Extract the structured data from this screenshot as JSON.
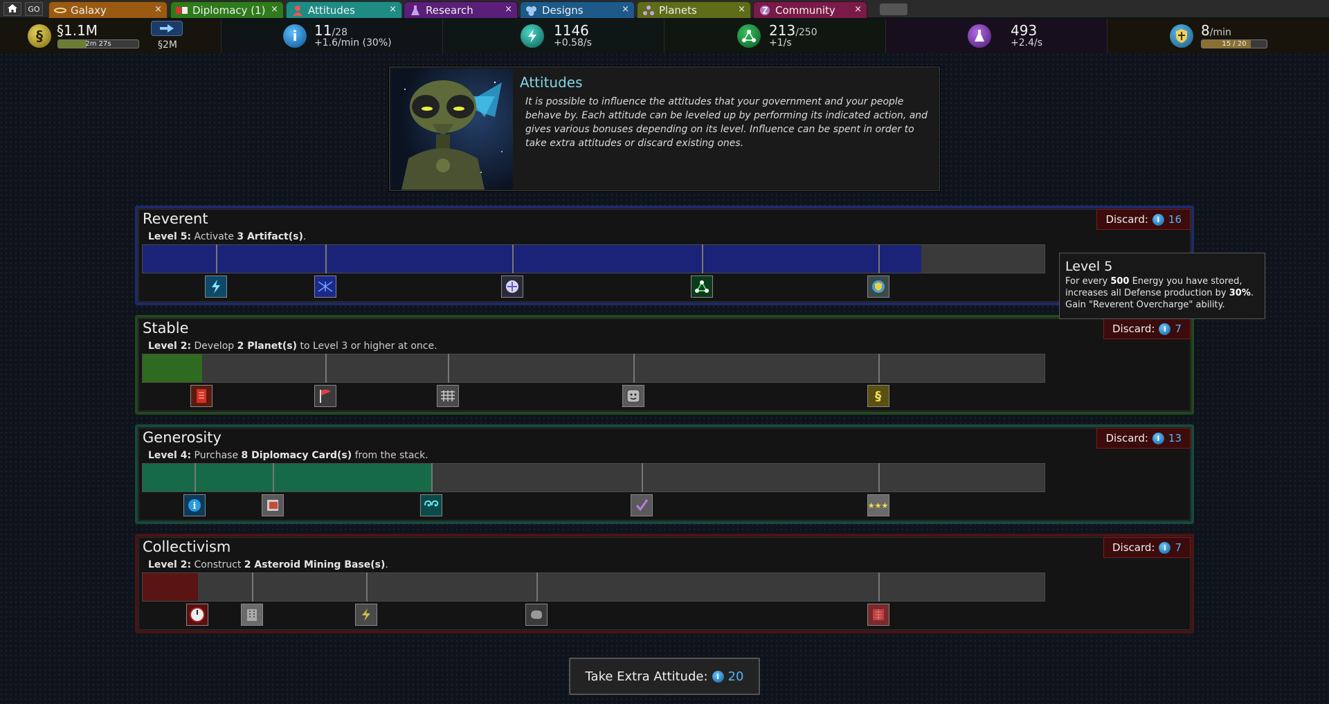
{
  "tabbar": {
    "home_icon": "home-icon",
    "go_label": "GO",
    "tabs": [
      {
        "label": "Galaxy",
        "icon": "galaxy-icon",
        "color": "#9a5a12"
      },
      {
        "label": "Diplomacy (1)",
        "icon": "diplomacy-cards-icon",
        "color": "#2f7a1c"
      },
      {
        "label": "Attitudes",
        "icon": "attitudes-icon",
        "color": "#1f8c84"
      },
      {
        "label": "Research",
        "icon": "research-flask-icon",
        "color": "#5a1f78"
      },
      {
        "label": "Designs",
        "icon": "designs-hex-icon",
        "color": "#1d5a8a"
      },
      {
        "label": "Planets",
        "icon": "planets-icon",
        "color": "#5f6c18"
      },
      {
        "label": "Community",
        "icon": "community-icon",
        "color": "#7a1a48"
      }
    ],
    "close_glyph": "×"
  },
  "resources": {
    "money": {
      "icon": "money-icon",
      "value": "§1.1M",
      "timer": "2m 27s",
      "timer_progress": 0.35,
      "transfer_icon": "transfer-arrow-icon",
      "transfer_value": "§2M"
    },
    "influence": {
      "icon": "influence-icon",
      "value": "11",
      "max": "/28",
      "rate": "+1.6/min (30%)"
    },
    "energy": {
      "icon": "energy-icon",
      "value": "1146",
      "rate": "+0.58/s"
    },
    "industry": {
      "icon": "industry-icon",
      "value": "213",
      "max": "/250",
      "rate": "+1/s"
    },
    "research": {
      "icon": "research-icon",
      "value": "493",
      "rate": "+2.4/s"
    },
    "defense": {
      "icon": "defense-icon",
      "value": "8",
      "unit": "/min",
      "bar_text": "15 / 20",
      "bar_progress": 0.75
    }
  },
  "intro": {
    "title": "Attitudes",
    "text": "It is possible to influence the attitudes that your government and your people behave by. Each attitude can be leveled up by performing its indicated action, and gives various bonuses depending on its level. Influence can be spent in order to take extra attitudes or discard existing ones."
  },
  "discard_label": "Discard:",
  "attitudes": [
    {
      "name": "Reverent",
      "level_label": "Level 5:",
      "action_pre": "Activate ",
      "action_bold": "3 Artifact(s)",
      "action_post": ".",
      "discard_cost": "16",
      "color": "#1b2378",
      "frame_color": "#1e2a6a",
      "progress": 0.862,
      "ticks": [
        0.082,
        0.203,
        0.41,
        0.62,
        0.815
      ],
      "icons": [
        "energy-bolt-icon",
        "crossed-blue-icon",
        "artifact-orb-icon",
        "industry-icon",
        "defense-shield-icon"
      ]
    },
    {
      "name": "Stable",
      "level_label": "Level 2:",
      "action_pre": "Develop ",
      "action_bold": "2 Planet(s)",
      "action_post": " to Level 3 or higher at once.",
      "discard_cost": "7",
      "color": "#2e6a1f",
      "frame_color": "#1f4a1c",
      "progress": 0.066,
      "ticks": [
        0.203,
        0.339,
        0.544,
        0.815
      ],
      "icons": [
        "red-document-icon",
        "red-flag-icon",
        "metal-grid-icon",
        "smiley-face-icon",
        "money-icon"
      ]
    },
    {
      "name": "Generosity",
      "level_label": "Level 4:",
      "action_pre": "Purchase ",
      "action_bold": "8 Diplomacy Card(s)",
      "action_post": " from the stack.",
      "discard_cost": "13",
      "color": "#176a48",
      "frame_color": "#154a3a",
      "progress": 0.32,
      "ticks": [
        0.058,
        0.145,
        0.32,
        0.553,
        0.815
      ],
      "icons": [
        "influence-icon",
        "card-stack-icon",
        "swirl-icon",
        "checkmark-icon",
        "three-stars-icon"
      ]
    },
    {
      "name": "Collectivism",
      "level_label": "Level 2:",
      "action_pre": "Construct ",
      "action_bold": "2 Asteroid Mining Base(s)",
      "action_post": ".",
      "discard_cost": "7",
      "color": "#5a1414",
      "frame_color": "#4a1414",
      "progress": 0.061,
      "ticks": [
        0.122,
        0.248,
        0.437,
        0.815
      ],
      "icons": [
        "gauge-icon",
        "building-icon",
        "lightning-crate-icon",
        "asteroid-icon",
        "red-circuit-icon"
      ]
    }
  ],
  "tooltip": {
    "title": "Level 5",
    "line1_pre": "For every ",
    "line1_bold": "500",
    "line1_post": " Energy you have stored,",
    "line2_pre": "increases all Defense production by ",
    "line2_bold": "30%",
    "line2_post": ".",
    "line3": "Gain \"Reverent Overcharge\" ability."
  },
  "extra_button": {
    "label": "Take Extra Attitude:",
    "cost": "20"
  }
}
